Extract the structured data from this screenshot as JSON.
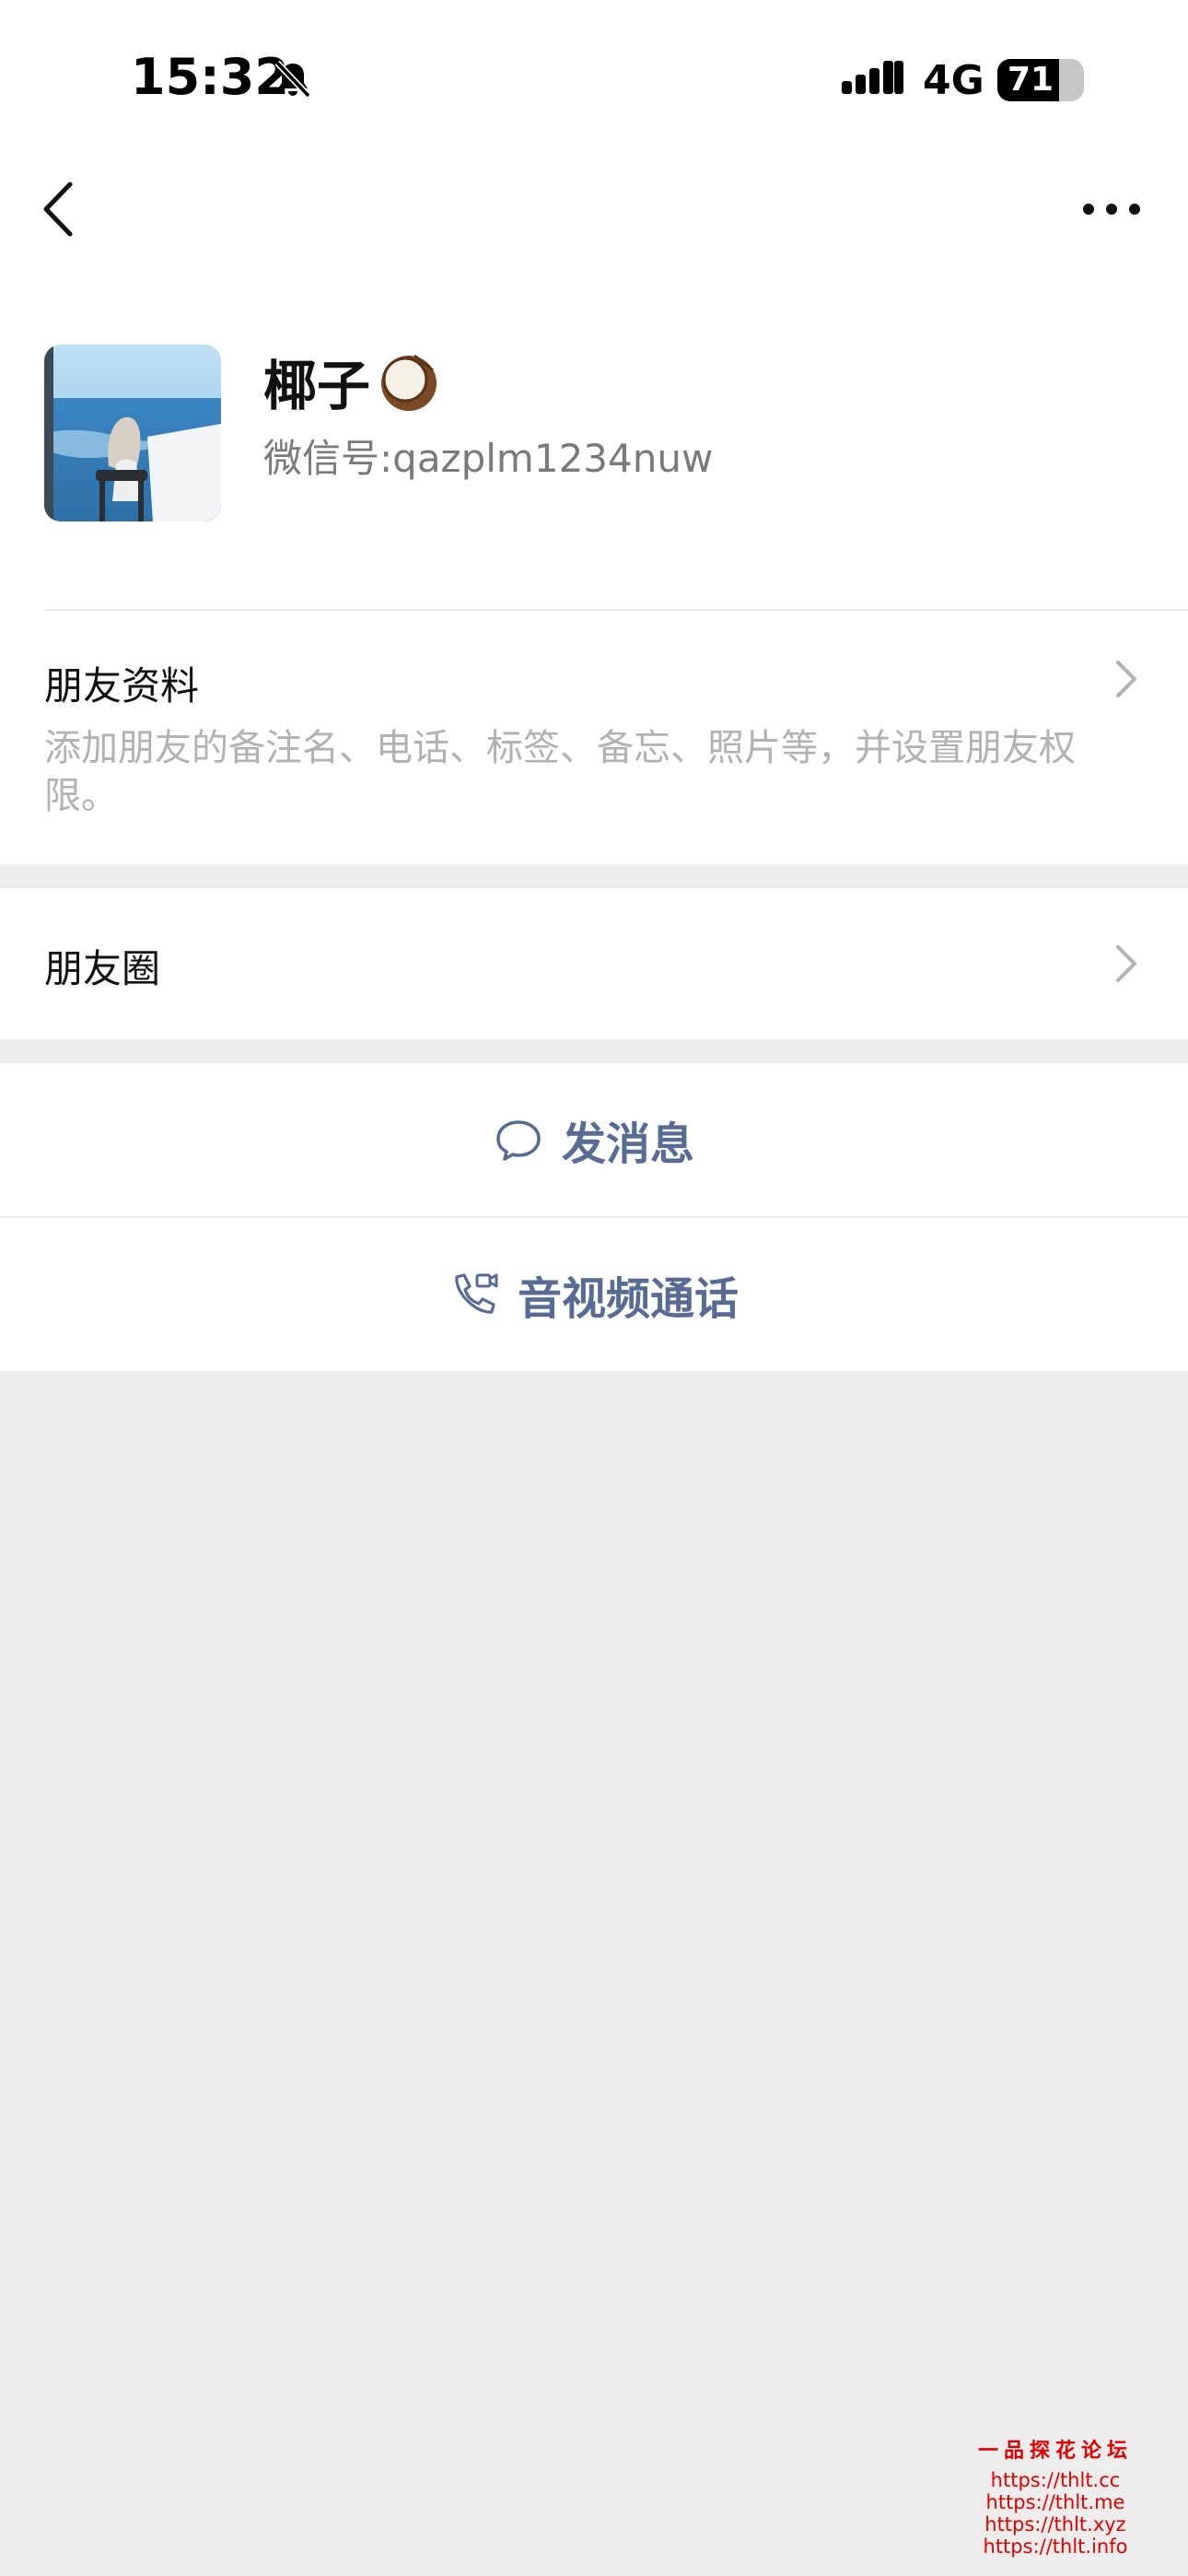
{
  "status_bar": {
    "time": "15:32",
    "network": "4G",
    "battery_percent": 71,
    "battery_label": "71",
    "icons": [
      "bell-slash-icon",
      "cellular-signal-icon",
      "battery-icon"
    ]
  },
  "nav": {
    "back_icon": "chevron-left-icon",
    "more_icon": "ellipsis-icon"
  },
  "profile": {
    "name": "椰子",
    "name_emoji_icon": "coconut-emoji-icon",
    "wechat_id_label": "微信号:",
    "wechat_id": "qazplm1234nuw"
  },
  "rows": {
    "friend_info_title": "朋友资料",
    "friend_info_desc": "添加朋友的备注名、电话、标签、备忘、照片等，并设置朋友权限。",
    "moments_title": "朋友圈"
  },
  "actions": {
    "message_label": "发消息",
    "call_label": "音视频通话"
  },
  "watermark": {
    "title": "一品探花论坛",
    "links": [
      "https://thlt.cc",
      "https://thlt.me",
      "https://thlt.xyz",
      "https://thlt.info"
    ]
  },
  "colors": {
    "link_blue": "#576b95",
    "background_gray": "#ededed",
    "watermark_red": "#e50000"
  }
}
